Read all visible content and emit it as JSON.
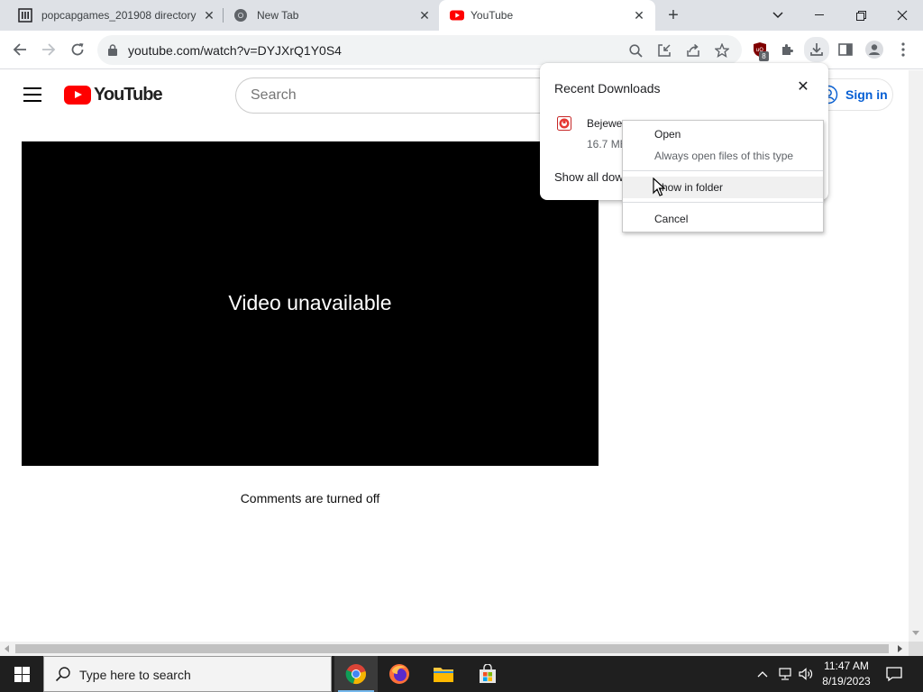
{
  "browser": {
    "tabs": [
      {
        "title": "popcapgames_201908 directory"
      },
      {
        "title": "New Tab"
      },
      {
        "title": "YouTube"
      }
    ],
    "url": "youtube.com/watch?v=DYJXrQ1Y0S4",
    "extension_badge": "8"
  },
  "youtube": {
    "logo_text": "YouTube",
    "search_placeholder": "Search",
    "sign_in": "Sign in",
    "player_message": "Video unavailable",
    "comments_status": "Comments are turned off"
  },
  "downloads": {
    "header": "Recent Downloads",
    "file_name": "Bejeweled",
    "file_size": "16.7 MB",
    "show_all": "Show all downloads"
  },
  "context_menu": {
    "items": [
      "Open",
      "Always open files of this type",
      "Show in folder",
      "Cancel"
    ]
  },
  "taskbar": {
    "search_placeholder": "Type here to search",
    "time": "11:47 AM",
    "date": "8/19/2023"
  },
  "colors": {
    "youtube_red": "#ff0000",
    "link_blue": "#065fd4",
    "taskbar": "#1f1f1f"
  }
}
